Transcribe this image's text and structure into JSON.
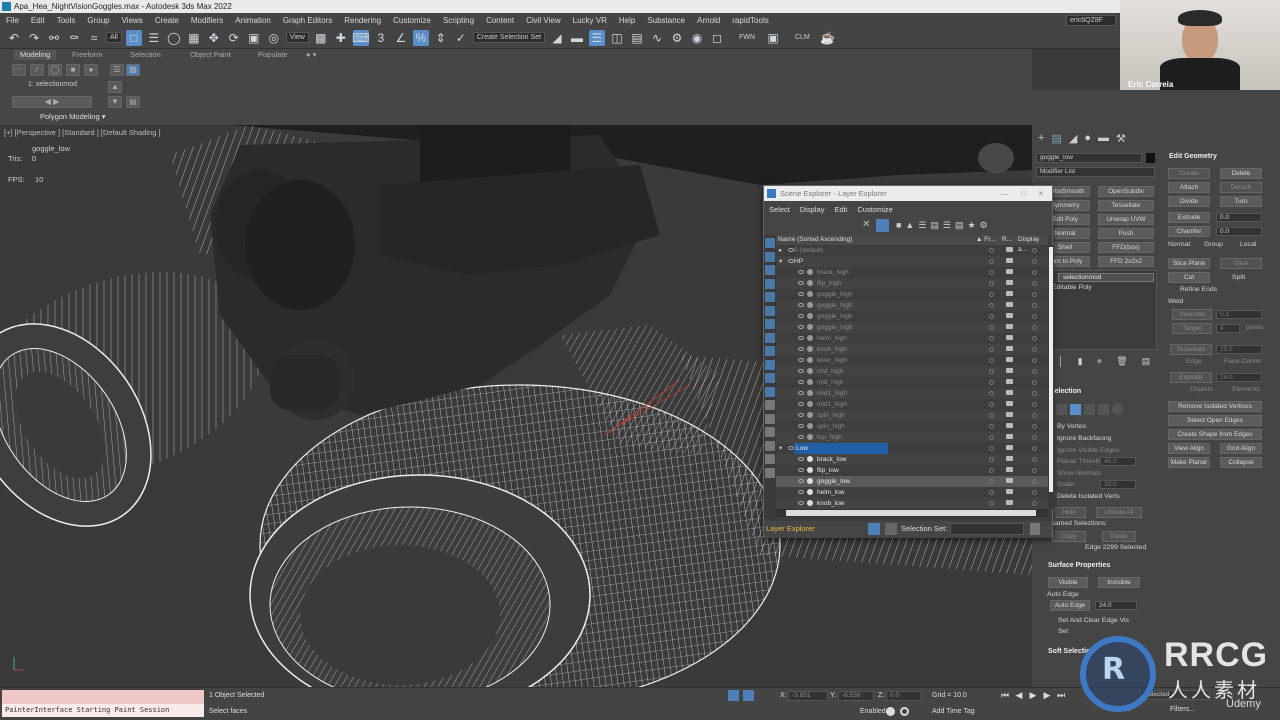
{
  "window": {
    "title": "Apa_Hea_NightVisionGoggles.max - Autodesk 3ds Max 2022"
  },
  "menu": [
    "File",
    "Edit",
    "Tools",
    "Group",
    "Views",
    "Create",
    "Modifiers",
    "Animation",
    "Graph Editors",
    "Rendering",
    "Customize",
    "Scripting",
    "Content",
    "Civil View",
    "Lucky VR",
    "Help",
    "Substance",
    "Arnold",
    "rapidTools"
  ],
  "user": "eric6QZ8F",
  "toolbar": {
    "filter": "All",
    "view": "View",
    "selection_set": "Create Selection Set",
    "fwn": "FWN",
    "clm": "CLM"
  },
  "ribbon": {
    "tabs": [
      "Modeling",
      "Freeform",
      "Selection",
      "Object Paint",
      "Populate"
    ],
    "active_tab": "Modeling",
    "modifier_label": "1: selectionmod",
    "panel_label": "Polygon Modeling ▾"
  },
  "viewport": {
    "label": "[+] [Perspective ] [Standard ] [Default Shading ]",
    "object_name": "goggle_low",
    "tris_label": "Tris:",
    "tris_value": "0",
    "fps_label": "FPS:",
    "fps_value": "10"
  },
  "webcam": {
    "name": "Eric Correia"
  },
  "scene_explorer": {
    "title": "Scene Explorer - Layer Explorer",
    "menu": [
      "Select",
      "Display",
      "Edit",
      "Customize"
    ],
    "col_name": "Name (Sorted Ascending)",
    "col_fr": "▲ Fr...",
    "col_r": "R...",
    "col_display": "Display a...",
    "rows": [
      {
        "name": "0 (default)",
        "indent": 30,
        "kind": "layer",
        "dim": true
      },
      {
        "name": "HP",
        "indent": 30,
        "kind": "layer-open",
        "dim": false
      },
      {
        "name": "brack_high",
        "indent": 53,
        "kind": "obj",
        "dim": true
      },
      {
        "name": "flip_high",
        "indent": 53,
        "kind": "obj",
        "dim": true
      },
      {
        "name": "goggle_high",
        "indent": 53,
        "kind": "obj",
        "dim": true
      },
      {
        "name": "goggle_high",
        "indent": 53,
        "kind": "obj",
        "dim": true
      },
      {
        "name": "goggle_high",
        "indent": 53,
        "kind": "obj",
        "dim": true
      },
      {
        "name": "goggle_high",
        "indent": 53,
        "kind": "obj",
        "dim": true
      },
      {
        "name": "helm_high",
        "indent": 53,
        "kind": "obj",
        "dim": true
      },
      {
        "name": "knob_high",
        "indent": 53,
        "kind": "obj",
        "dim": true
      },
      {
        "name": "lever_high",
        "indent": 53,
        "kind": "obj",
        "dim": true
      },
      {
        "name": "mid_high",
        "indent": 53,
        "kind": "obj",
        "dim": true
      },
      {
        "name": "mid_high",
        "indent": 53,
        "kind": "obj",
        "dim": true
      },
      {
        "name": "mid1_high",
        "indent": 53,
        "kind": "obj",
        "dim": true
      },
      {
        "name": "mid1_high",
        "indent": 53,
        "kind": "obj",
        "dim": true
      },
      {
        "name": "spin_high",
        "indent": 53,
        "kind": "obj",
        "dim": true
      },
      {
        "name": "spin_high",
        "indent": 53,
        "kind": "obj",
        "dim": true
      },
      {
        "name": "top_high",
        "indent": 53,
        "kind": "obj",
        "dim": true
      },
      {
        "name": "Low",
        "indent": 30,
        "kind": "layer-sel",
        "dim": false
      },
      {
        "name": "brack_low",
        "indent": 53,
        "kind": "obj",
        "dim": false
      },
      {
        "name": "flip_low",
        "indent": 53,
        "kind": "obj",
        "dim": false
      },
      {
        "name": "goggle_low",
        "indent": 53,
        "kind": "obj-hl",
        "dim": false
      },
      {
        "name": "helm_low",
        "indent": 53,
        "kind": "obj",
        "dim": false
      },
      {
        "name": "knob_low",
        "indent": 53,
        "kind": "obj",
        "dim": false
      }
    ],
    "footer_label": "Layer Explorer",
    "selection_set_label": "Selection Set:"
  },
  "command_panel": {
    "object_name": "goggle_low",
    "modifier_list": "Modifier List",
    "mod_buttons": [
      [
        "TurboSmooth",
        "OpenSubdiv"
      ],
      [
        "Symmetry",
        "Tessellate"
      ],
      [
        "Edit Poly",
        "Unwrap UVW"
      ],
      [
        "Normal",
        "Push"
      ],
      [
        "Shell",
        "FFD(box)"
      ],
      [
        "Turn to Poly",
        "FFD 2x2x2"
      ]
    ],
    "stack": [
      "selectionmod",
      "Editable Poly"
    ],
    "selection_head": "Selection",
    "by_vertex": "By Vertex",
    "ignore_backfacing": "Ignore Backfacing",
    "ignore_visible_edges": "Ignore Visible Edges",
    "planar_thresh": "Planar Thresh:",
    "planar_thresh_val": "45.0",
    "show_normals": "Show Normals",
    "scale_label": "Scale:",
    "scale_val": "20.0",
    "delete_isolated": "Delete Isolated Verts",
    "hide": "Hide",
    "unhide_all": "Unhide All",
    "named_selections": "Named Selections:",
    "copy": "Copy",
    "paste": "Paste",
    "edge_count": "Edge 2299 Selected",
    "surface_head": "Surface Properties",
    "visible": "Visible",
    "invisible": "Invisible",
    "auto_edge": "Auto Edge",
    "auto_edge_btn": "Auto Edge",
    "auto_edge_val": "24.0",
    "set_clear": "Set And Clear Edge Vis",
    "set": "Set",
    "soft_selection": "Soft Selection",
    "edit_geometry": "Edit Geometry",
    "eg": {
      "create": "Create",
      "delete": "Delete",
      "attach": "Attach",
      "detach": "Detach",
      "divide": "Divide",
      "turn": "Turn",
      "extrude": "Extrude",
      "extrude_val": "0.0",
      "chamfer": "Chamfer",
      "chamfer_val": "0.0",
      "normal": "Normal:",
      "group": "Group",
      "local": "Local",
      "slice_plane": "Slice Plane",
      "slice": "Slice",
      "cut": "Cut",
      "split": "Split",
      "refine_ends": "Refine Ends",
      "weld": "Weld",
      "selected": "Selected",
      "selected_val": "0.1",
      "target": "Target",
      "target_val": "4",
      "pixels": "pixels",
      "tessellate": "Tessellate",
      "tess_val": "25.0",
      "edge": "Edge",
      "face_center": "Face-Center",
      "explode": "Explode",
      "explode_val": "24.0",
      "objects": "Objects",
      "elements": "Elements",
      "remove_isolated": "Remove Isolated Vertices",
      "select_open_edges": "Select Open Edges",
      "create_shape": "Create Shape from Edges",
      "view_align": "View Align",
      "grid_align": "Grid Align",
      "make_planar": "Make Planar",
      "collapse": "Collapse"
    }
  },
  "status": {
    "maxscript_out": "PainterInterface Starting Paint Session",
    "objects_selected": "1 Object Selected",
    "prompt": "Select faces",
    "x_label": "X:",
    "x_val": "-3.851",
    "y_label": "Y:",
    "y_val": "-6.538",
    "z_label": "Z:",
    "z_val": "0.0",
    "grid": "Grid = 10.0",
    "enabled": "Enabled:",
    "add_time_tag": "Add Time Tag",
    "set_key": "Set K.",
    "selected": "Selected",
    "filters": "Filters..."
  },
  "watermark": {
    "brand": "RRCG",
    "sub": "人人素材",
    "udemy": "Udemy"
  },
  "colors": {
    "accent": "#5a8fc9",
    "selection": "#1f5fa8",
    "viewport": "#3b3b3b",
    "wire": "#eeeeee"
  }
}
